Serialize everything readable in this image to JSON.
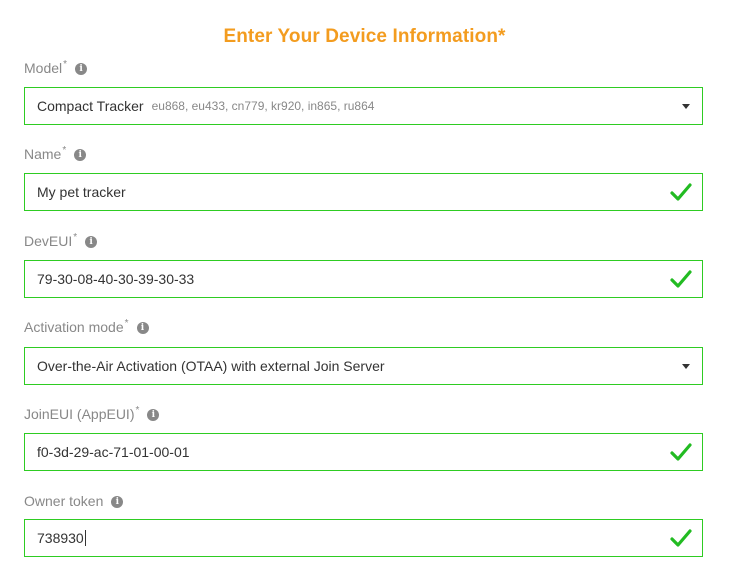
{
  "title": "Enter Your Device Information*",
  "fields": {
    "model": {
      "label": "Model",
      "required": "*",
      "value": "Compact Tracker",
      "sub": "eu868, eu433, cn779, kr920, in865, ru864"
    },
    "name": {
      "label": "Name",
      "required": "*",
      "value": "My pet tracker"
    },
    "deveui": {
      "label": "DevEUI",
      "required": "*",
      "value": "79-30-08-40-30-39-30-33"
    },
    "activation": {
      "label": "Activation mode",
      "required": "*",
      "value": "Over-the-Air Activation (OTAA) with external Join Server"
    },
    "joineui": {
      "label": "JoinEUI (AppEUI)",
      "required": "*",
      "value": "f0-3d-29-ac-71-01-00-01"
    },
    "owner_token": {
      "label": "Owner token",
      "value": "738930"
    }
  },
  "info_icon_glyph": "i",
  "colors": {
    "accent": "#f39c1f",
    "valid": "#2ecc22",
    "label": "#888888"
  },
  "icons": {
    "info": "info-icon",
    "valid": "check-icon",
    "dropdown": "caret-down-icon"
  }
}
